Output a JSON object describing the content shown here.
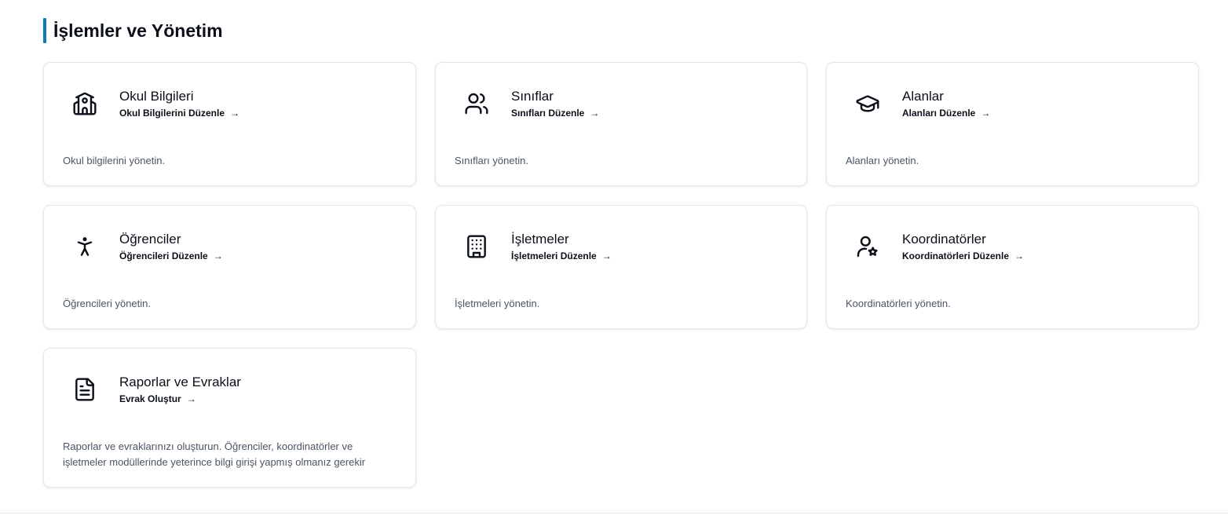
{
  "section": {
    "title": "İşlemler ve Yönetim"
  },
  "cards": [
    {
      "title": "Okul Bilgileri",
      "link": "Okul Bilgilerini Düzenle",
      "arrow": "→",
      "description": "Okul bilgilerini yönetin.",
      "icon": "school-icon"
    },
    {
      "title": "Sınıflar",
      "link": "Sınıfları Düzenle",
      "arrow": "→",
      "description": "Sınıfları yönetin.",
      "icon": "users-icon"
    },
    {
      "title": "Alanlar",
      "link": "Alanları Düzenle",
      "arrow": "→",
      "description": "Alanları yönetin.",
      "icon": "graduation-cap-icon"
    },
    {
      "title": "Öğrenciler",
      "link": "Öğrencileri Düzenle",
      "arrow": "→",
      "description": "Öğrencileri yönetin.",
      "icon": "accessibility-person-icon"
    },
    {
      "title": "İşletmeler",
      "link": "İşletmeleri Düzenle",
      "arrow": "→",
      "description": "İşletmeleri yönetin.",
      "icon": "building-icon"
    },
    {
      "title": "Koordinatörler",
      "link": "Koordinatörleri Düzenle",
      "arrow": "→",
      "description": "Koordinatörleri yönetin.",
      "icon": "user-star-icon"
    },
    {
      "title": "Raporlar ve Evraklar",
      "link": "Evrak Oluştur",
      "arrow": "→",
      "description": "Raporlar ve evraklarınızı oluşturun. Öğrenciler, koordinatörler ve işletmeler modüllerinde yeterince bilgi girişi yapmış olmanız gerekir",
      "icon": "document-icon"
    }
  ],
  "colors": {
    "accent_bar": "#0f7bb5",
    "card_border": "#e3e6ea",
    "description_text": "#4b5563",
    "title_text": "#0b0f19"
  }
}
